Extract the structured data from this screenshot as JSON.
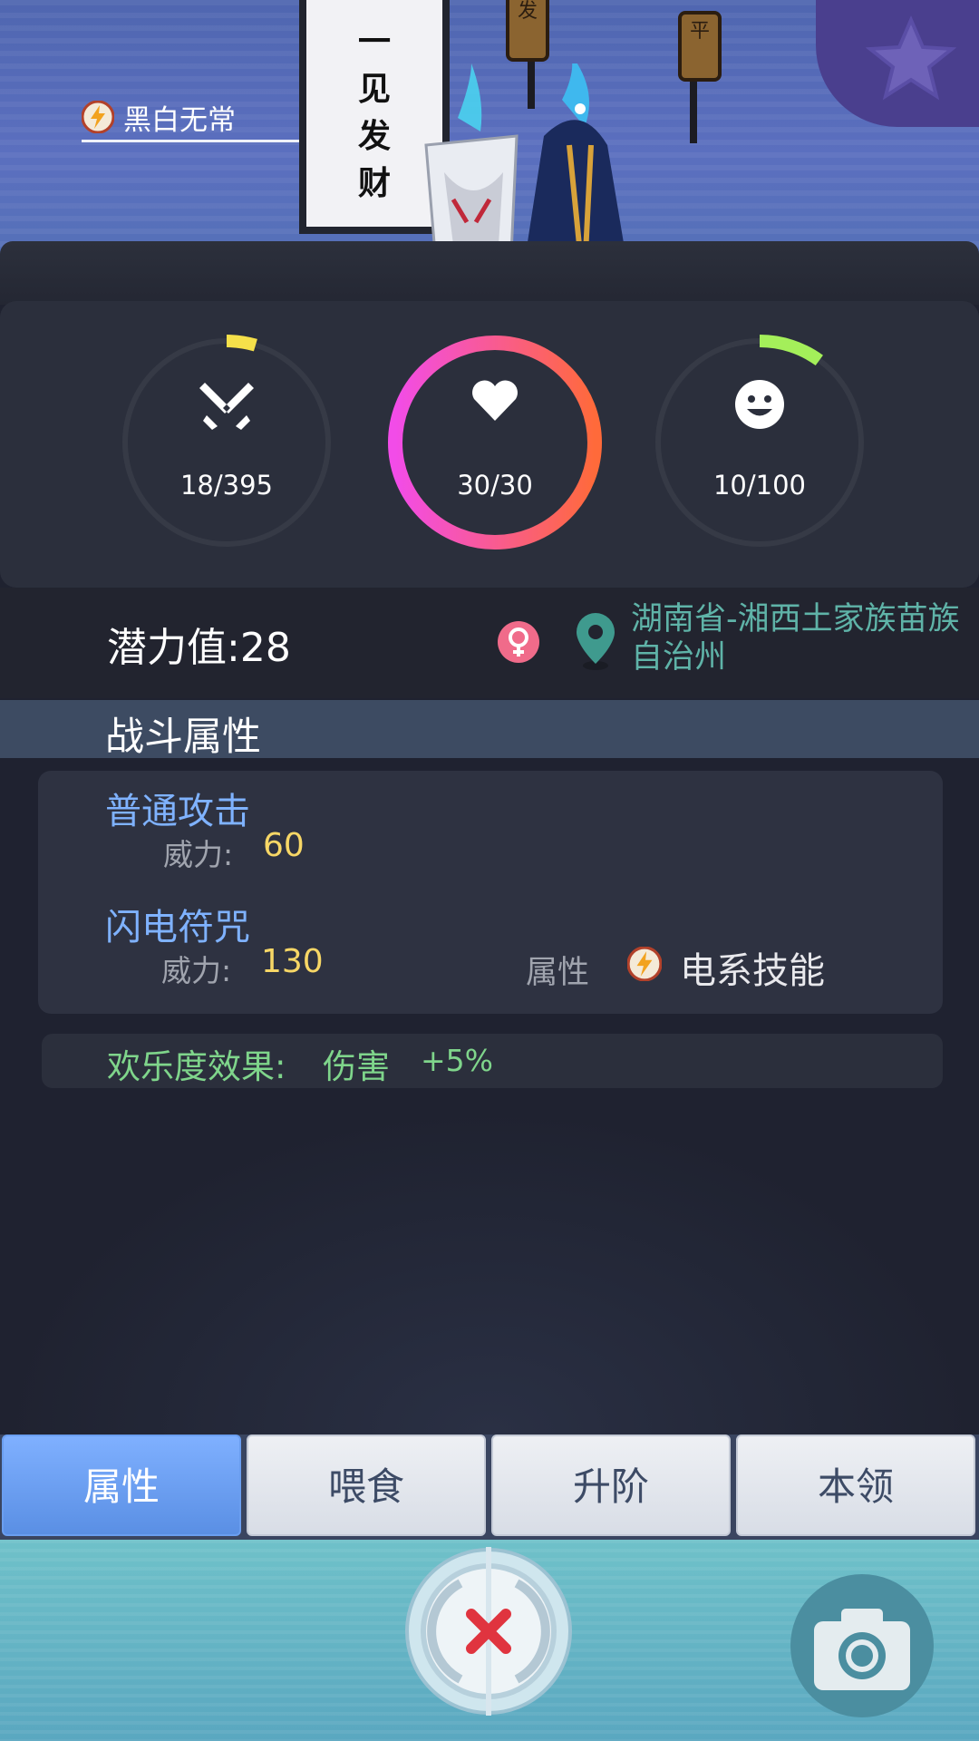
{
  "pet": {
    "name": "黑白无常",
    "banner_text": "一见发财",
    "sign_left": "发",
    "sign_right": "平"
  },
  "stats": {
    "attack": {
      "icon": "crossed-swords-icon",
      "value": "18/395",
      "fraction": 0.046,
      "color": "#f5e04a"
    },
    "hp": {
      "icon": "heart-icon",
      "value": "30/30",
      "fraction": 1.0
    },
    "happiness": {
      "icon": "smiley-icon",
      "value": "10/100",
      "fraction": 0.1,
      "color": "#a4ef5a"
    }
  },
  "info": {
    "potential_label": "潜力值:",
    "potential_value": "28",
    "gender_icon": "female-icon",
    "location_icon": "map-pin-icon",
    "location": "湖南省-湘西土家族苗族自治州"
  },
  "section": {
    "title": "战斗属性"
  },
  "skills": [
    {
      "name": "普通攻击",
      "power_label": "威力:",
      "power": "60"
    },
    {
      "name": "闪电符咒",
      "power_label": "威力:",
      "power": "130",
      "attr_label": "属性",
      "attr_icon": "lightning-icon",
      "attr_value": "电系技能"
    }
  ],
  "happiness_effect": {
    "label": "欢乐度效果:",
    "effect": "伤害",
    "value": "+5%"
  },
  "tabs": [
    {
      "label": "属性",
      "active": true
    },
    {
      "label": "喂食",
      "active": false
    },
    {
      "label": "升阶",
      "active": false
    },
    {
      "label": "本领",
      "active": false
    }
  ],
  "colors": {
    "accent_blue": "#5a8fe4",
    "skill_name": "#7fb2ff",
    "power_value": "#f7d766",
    "happy_green": "#7fd58b",
    "location_teal": "#5fb3a8"
  }
}
